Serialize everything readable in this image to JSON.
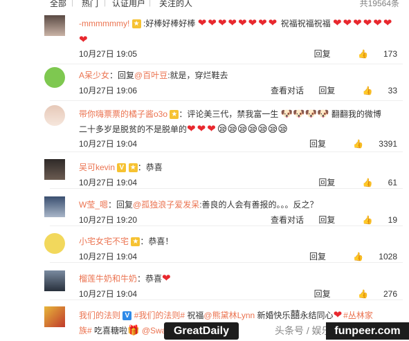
{
  "tabs": {
    "all": "全部",
    "hot": "热门",
    "verified": "认证用户",
    "following": "关注的人",
    "total": "共19564条"
  },
  "colors": {
    "link": "#eb7350",
    "heart": "#e8282e"
  },
  "comments": [
    {
      "user": "-mmmmmmy!",
      "text": ":好棒好棒好棒",
      "hearts1": "❤❤❤❤❤❤❤❤",
      "text2": "祝福祝福祝福",
      "hearts2": "❤❤❤❤❤❤❤",
      "time": "10月27日 19:05",
      "reply": "回复",
      "likes": "173"
    },
    {
      "user": "A呆少女",
      "prefix": "：回复",
      "at": "@百叶豆",
      "text": ":就是，穿烂鞋去",
      "time": "10月27日 19:06",
      "view": "查看对话",
      "reply": "回复",
      "likes": "33"
    },
    {
      "user": "带你嗨票票的橘子酱o3o",
      "text": "：评论美三代，禁我富一生",
      "text2": "翻翻我的微博",
      "line2": "二十多岁是脱贫的不是脱单的",
      "hearts": "❤❤❤",
      "faces": "😪😪😪😪😪😪😪",
      "time": "10月27日 19:04",
      "reply": "回复",
      "likes": "3391"
    },
    {
      "user": "吴可kevin",
      "text": "：恭喜",
      "time": "10月27日 19:04",
      "reply": "回复",
      "likes": "61"
    },
    {
      "user": "W莹_嗯",
      "prefix": "：回复",
      "at": "@孤独浪子爱发呆",
      "text": ":善良的人会有善报的。。。反之？",
      "time": "10月27日 19:20",
      "view": "查看对话",
      "reply": "回复",
      "likes": "19"
    },
    {
      "user": "小宅女宅不宅",
      "text": "：恭喜！",
      "time": "10月27日 19:04",
      "reply": "回复",
      "likes": "1028"
    },
    {
      "user": "榴莲牛奶和牛奶",
      "text": "：恭喜",
      "hearts": "❤",
      "time": "10月27日 19:04",
      "reply": "回复",
      "likes": "276"
    },
    {
      "user": "我们的法则",
      "hash1": "#我们的法则#",
      "text": "祝福",
      "at": "@熊黛林Lynn",
      "text2": "新婚快乐",
      "text3": "永结同心",
      "hash2": "#丛林家",
      "line2a": "族#",
      "line2b": "吃喜糖啦",
      "at2": "@Swaggy"
    }
  ],
  "watermark": {
    "left": "GreatDaily",
    "mid": "头条号 / 娱乐小喇叭",
    "right": "funpeer.com"
  }
}
